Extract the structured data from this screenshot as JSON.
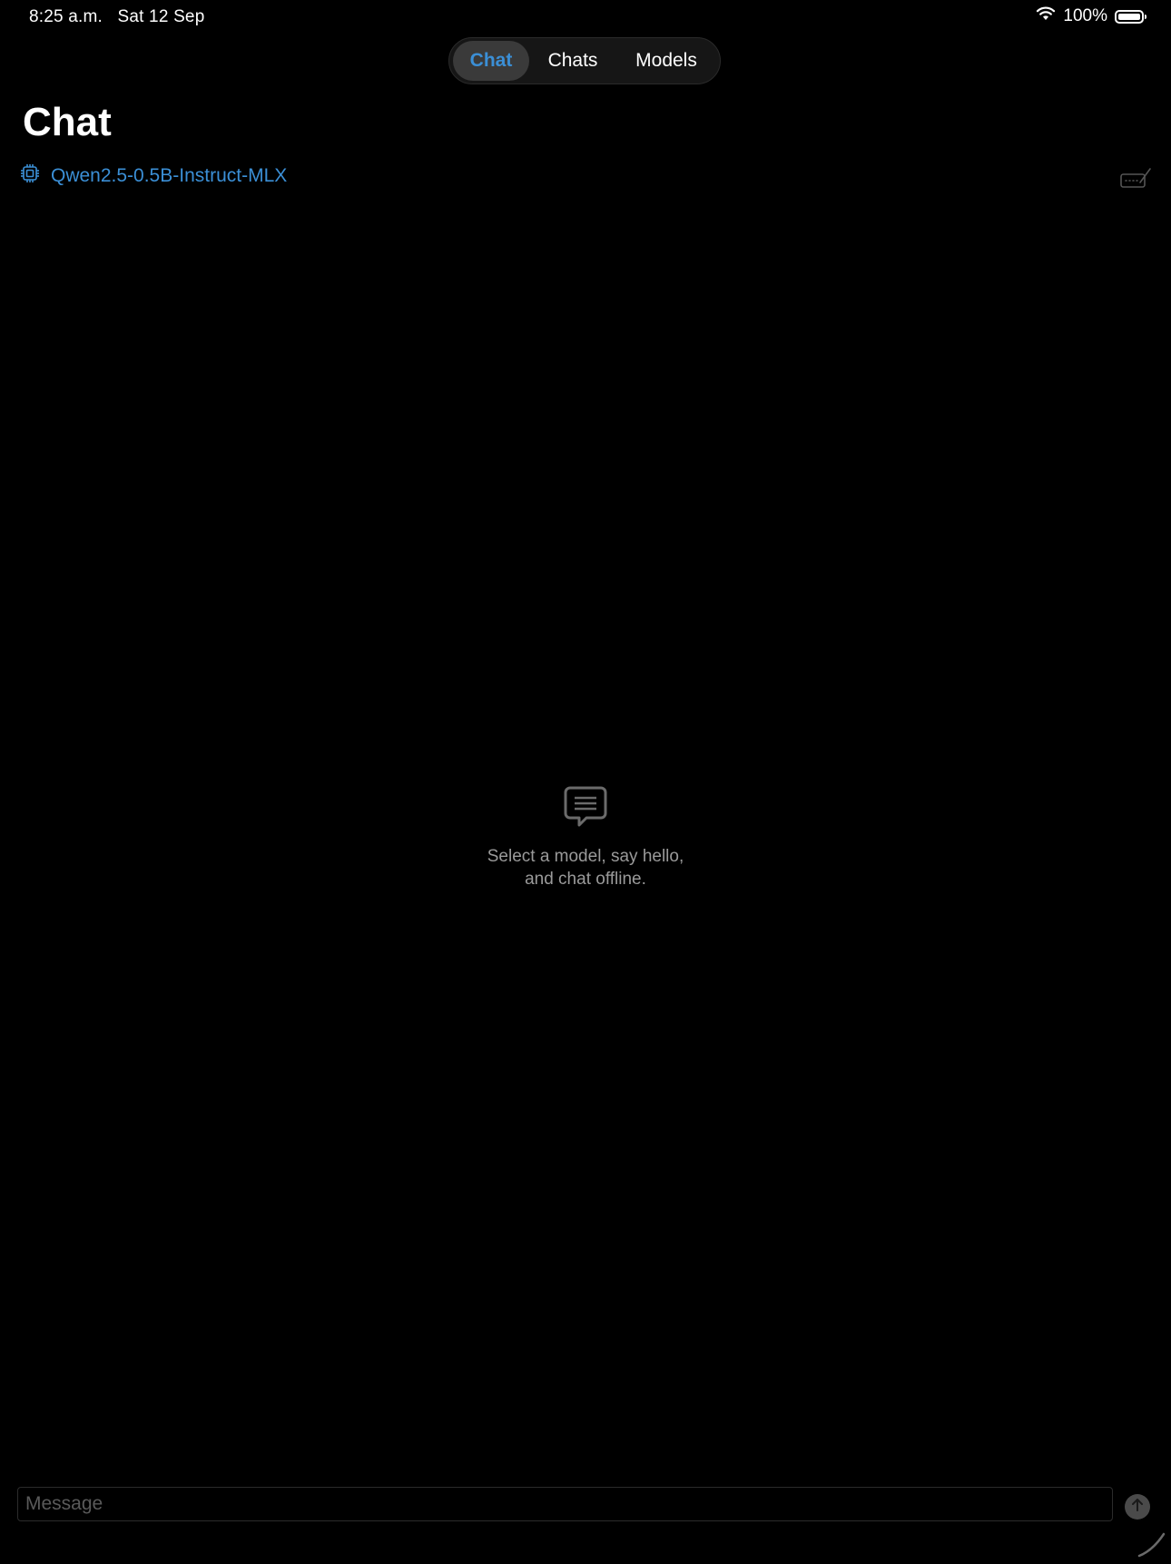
{
  "status_bar": {
    "time": "8:25 a.m.",
    "date": "Sat 12 Sep",
    "battery": "100%",
    "icons": [
      "wifi-icon",
      "battery-icon"
    ]
  },
  "tabs": [
    {
      "label": "Chat",
      "active": true
    },
    {
      "label": "Chats",
      "active": false
    },
    {
      "label": "Models",
      "active": false
    }
  ],
  "header": {
    "title": "Chat",
    "model_name": "Qwen2.5-0.5B-Instruct-MLX",
    "model_icon": "cpu-chip-icon",
    "keyboard_icon": "keyboard-dismiss-icon"
  },
  "empty_state": {
    "icon": "chat-bubble-text-icon",
    "line1": "Select a model, say hello,",
    "line2": "and chat offline."
  },
  "composer": {
    "placeholder": "Message",
    "value": "",
    "send_icon": "arrow-up-circle-icon"
  },
  "colors": {
    "background": "#000000",
    "accent": "#3b8fd6",
    "secondary_text": "#9a9a9a",
    "segment_active_bg": "#3a3a3a"
  }
}
